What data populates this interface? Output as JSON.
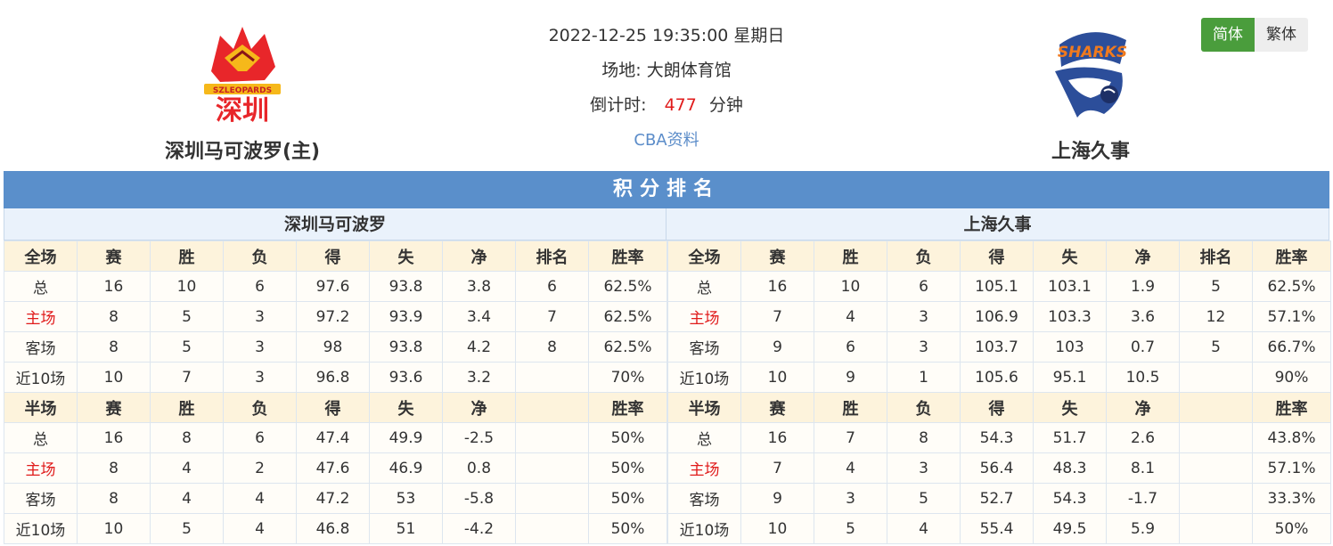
{
  "colors": {
    "accent_blue": "#5a8fcb",
    "active_green": "#4a9d3c",
    "countdown_red": "#e01b1b",
    "header_row": "#fdf3dc"
  },
  "header": {
    "home_team": {
      "name": "深圳马可波罗(主)",
      "logo_text": "深圳",
      "logo_subtext": "SZLEOPARDS",
      "logo_icon": "leopard-logo-icon"
    },
    "away_team": {
      "name": "上海久事",
      "logo_text": "SHARKS",
      "logo_icon": "shark-logo-icon"
    },
    "datetime": "2022-12-25 19:35:00 星期日",
    "venue_label": "场地:",
    "venue": "大朗体育馆",
    "countdown_label": "倒计时:",
    "countdown_value": "477",
    "countdown_unit": "分钟",
    "cba_link": "CBA资料"
  },
  "lang_toggle": {
    "simplified": "简体",
    "traditional": "繁体"
  },
  "standings": {
    "title": "积分排名",
    "home": {
      "team": "深圳马可波罗",
      "full_header": [
        "全场",
        "赛",
        "胜",
        "负",
        "得",
        "失",
        "净",
        "排名",
        "胜率"
      ],
      "full_rows": [
        [
          "总",
          "16",
          "10",
          "6",
          "97.6",
          "93.8",
          "3.8",
          "6",
          "62.5%"
        ],
        [
          "主场",
          "8",
          "5",
          "3",
          "97.2",
          "93.9",
          "3.4",
          "7",
          "62.5%"
        ],
        [
          "客场",
          "8",
          "5",
          "3",
          "98",
          "93.8",
          "4.2",
          "8",
          "62.5%"
        ],
        [
          "近10场",
          "10",
          "7",
          "3",
          "96.8",
          "93.6",
          "3.2",
          "",
          "70%"
        ]
      ],
      "half_header": [
        "半场",
        "赛",
        "胜",
        "负",
        "得",
        "失",
        "净",
        "",
        "胜率"
      ],
      "half_rows": [
        [
          "总",
          "16",
          "8",
          "6",
          "47.4",
          "49.9",
          "-2.5",
          "",
          "50%"
        ],
        [
          "主场",
          "8",
          "4",
          "2",
          "47.6",
          "46.9",
          "0.8",
          "",
          "50%"
        ],
        [
          "客场",
          "8",
          "4",
          "4",
          "47.2",
          "53",
          "-5.8",
          "",
          "50%"
        ],
        [
          "近10场",
          "10",
          "5",
          "4",
          "46.8",
          "51",
          "-4.2",
          "",
          "50%"
        ]
      ]
    },
    "away": {
      "team": "上海久事",
      "full_header": [
        "全场",
        "赛",
        "胜",
        "负",
        "得",
        "失",
        "净",
        "排名",
        "胜率"
      ],
      "full_rows": [
        [
          "总",
          "16",
          "10",
          "6",
          "105.1",
          "103.1",
          "1.9",
          "5",
          "62.5%"
        ],
        [
          "主场",
          "7",
          "4",
          "3",
          "106.9",
          "103.3",
          "3.6",
          "12",
          "57.1%"
        ],
        [
          "客场",
          "9",
          "6",
          "3",
          "103.7",
          "103",
          "0.7",
          "5",
          "66.7%"
        ],
        [
          "近10场",
          "10",
          "9",
          "1",
          "105.6",
          "95.1",
          "10.5",
          "",
          "90%"
        ]
      ],
      "half_header": [
        "半场",
        "赛",
        "胜",
        "负",
        "得",
        "失",
        "净",
        "",
        "胜率"
      ],
      "half_rows": [
        [
          "总",
          "16",
          "7",
          "8",
          "54.3",
          "51.7",
          "2.6",
          "",
          "43.8%"
        ],
        [
          "主场",
          "7",
          "4",
          "3",
          "56.4",
          "48.3",
          "8.1",
          "",
          "57.1%"
        ],
        [
          "客场",
          "9",
          "3",
          "5",
          "52.7",
          "54.3",
          "-1.7",
          "",
          "33.3%"
        ],
        [
          "近10场",
          "10",
          "5",
          "4",
          "55.4",
          "49.5",
          "5.9",
          "",
          "50%"
        ]
      ]
    }
  }
}
